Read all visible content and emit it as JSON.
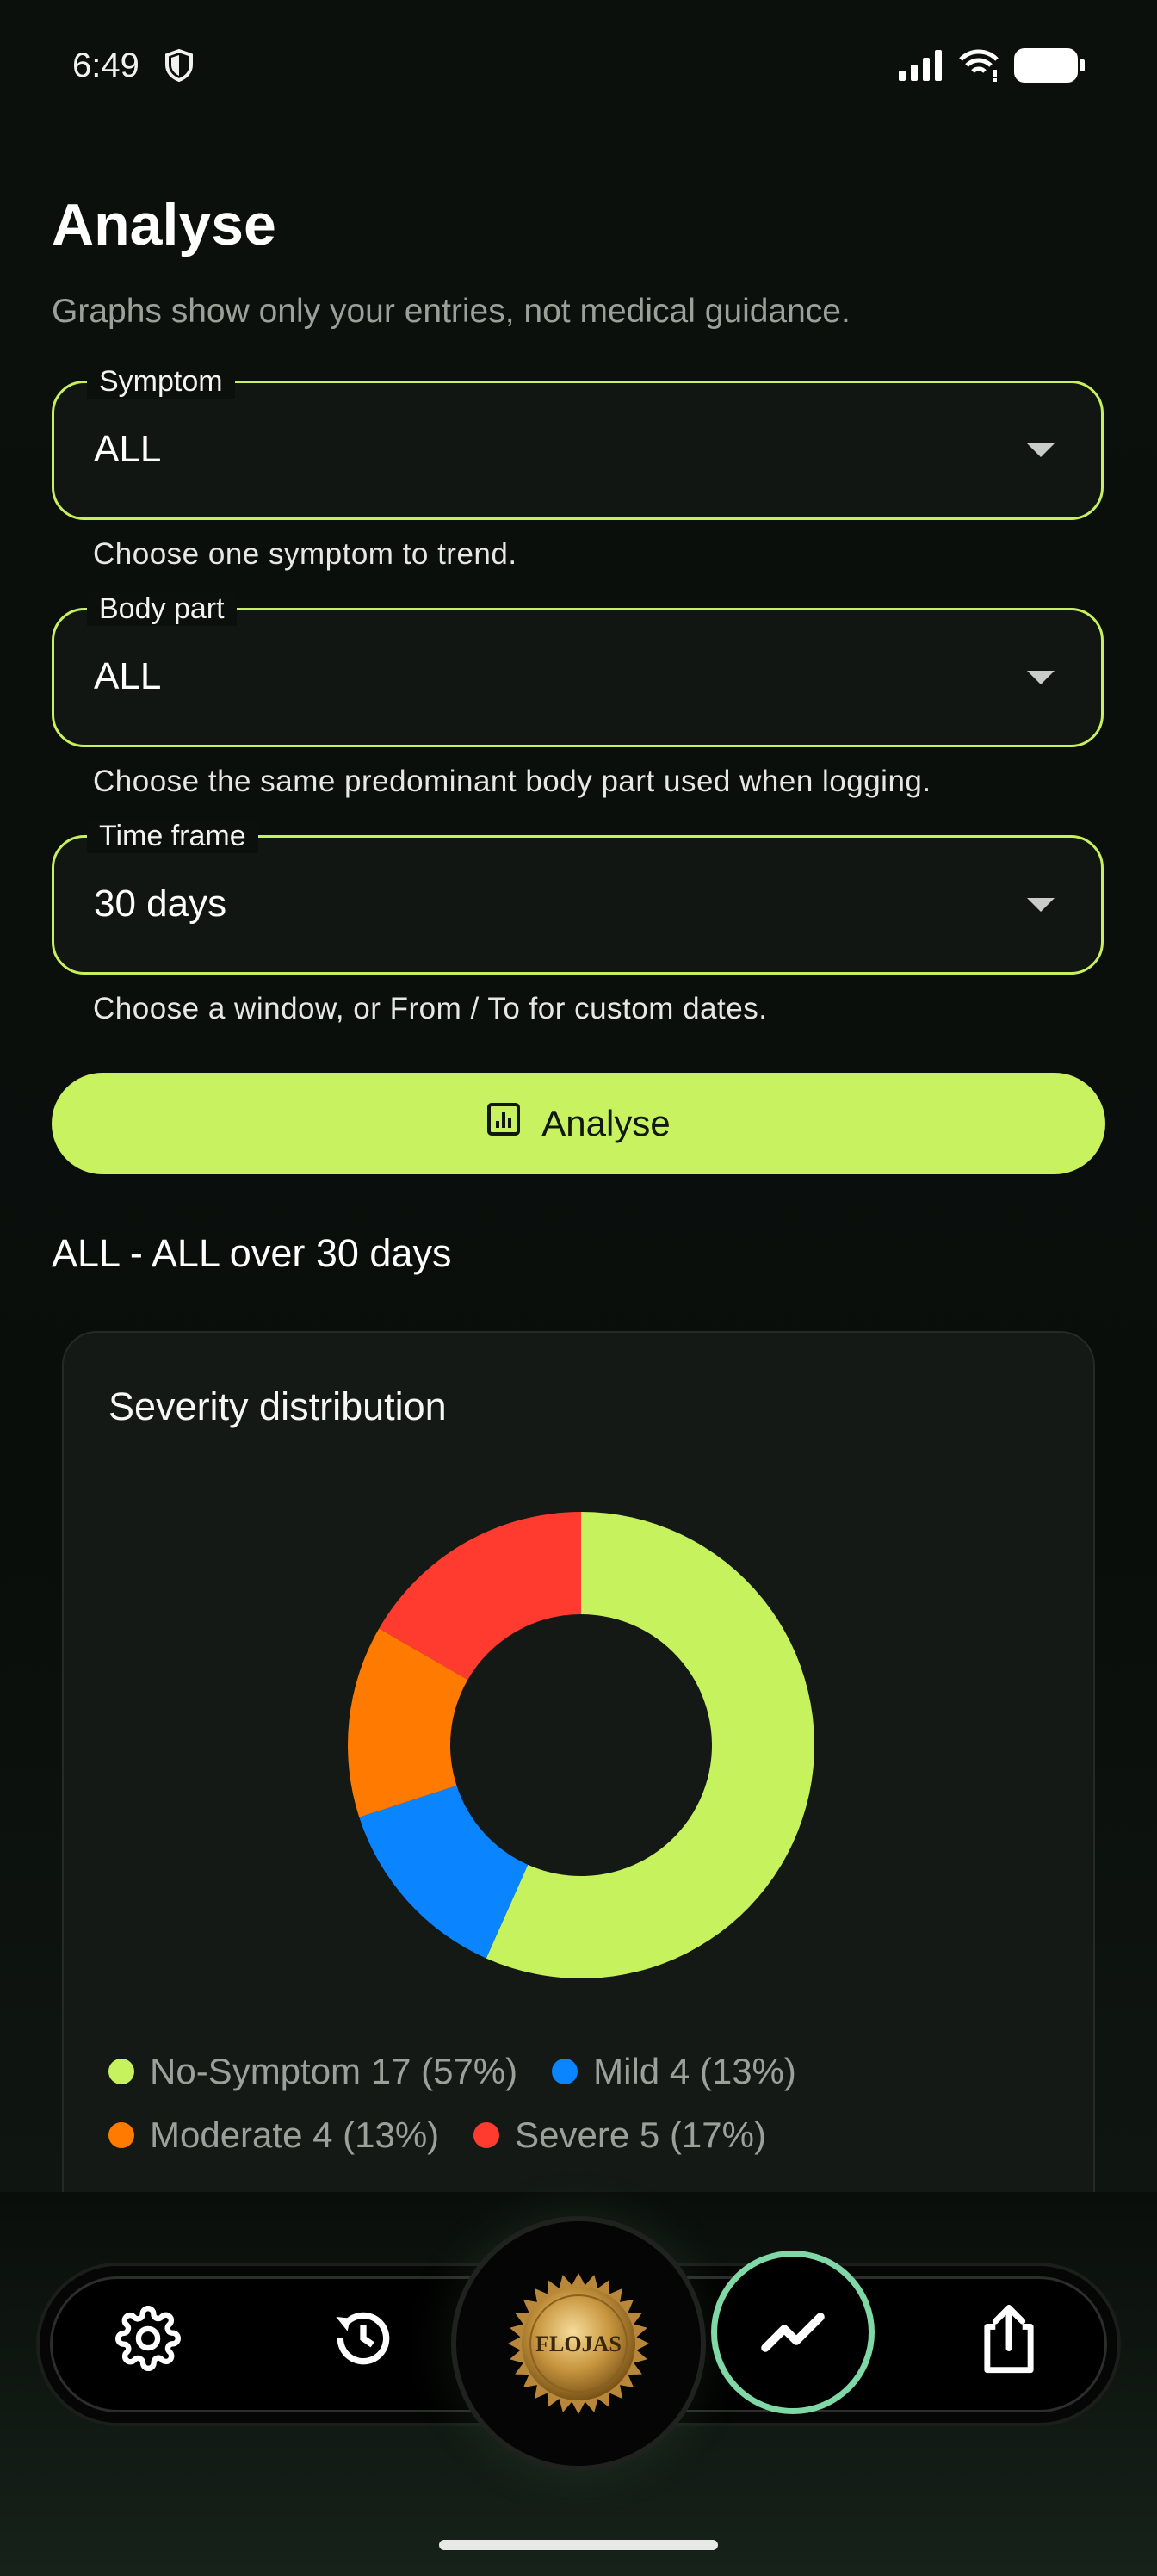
{
  "status": {
    "time": "6:49"
  },
  "page": {
    "title": "Analyse",
    "subtitle": "Graphs show only your entries, not medical guidance."
  },
  "fields": [
    {
      "label": "Symptom",
      "value": "ALL",
      "helper": "Choose one symptom to trend."
    },
    {
      "label": "Body part",
      "value": "ALL",
      "helper": "Choose the same predominant body part used when logging."
    },
    {
      "label": "Time frame",
      "value": "30 days",
      "helper": "Choose a window, or From / To for custom dates."
    }
  ],
  "analyse_button": {
    "label": "Analyse"
  },
  "result": {
    "range_text": "ALL - ALL over 30 days"
  },
  "chart_data": {
    "type": "pie",
    "title": "Severity distribution",
    "donut": true,
    "categories": [
      "No-Symptom",
      "Mild",
      "Moderate",
      "Severe"
    ],
    "values": [
      17,
      4,
      4,
      5
    ],
    "percents": [
      "57%",
      "13%",
      "13%",
      "17%"
    ],
    "colors": [
      "#c6f25e",
      "#0a84ff",
      "#ff7a00",
      "#ff3b30"
    ],
    "legend": [
      "No-Symptom 17 (57%)",
      "Mild 4 (13%)",
      "Moderate 4 (13%)",
      "Severe 5 (17%)"
    ]
  },
  "nav": {
    "items": [
      "gear-icon",
      "history-icon",
      "flojas-badge",
      "trend-icon",
      "share-icon"
    ],
    "badge_text": "FLOJAS",
    "active": "trend-icon"
  }
}
